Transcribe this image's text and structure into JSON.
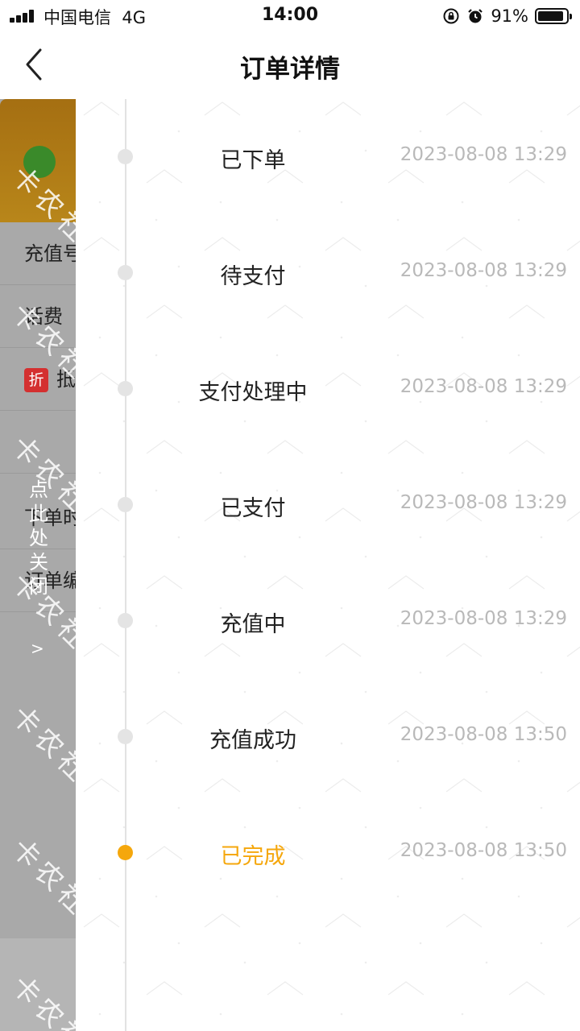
{
  "status_bar": {
    "carrier": "中国电信",
    "network": "4G",
    "time": "14:00",
    "battery_percent": "91%",
    "battery_level": 0.91,
    "icons": [
      "signal-icon",
      "rotation-lock-icon",
      "alarm-icon",
      "battery-icon"
    ]
  },
  "nav": {
    "title": "订单详情",
    "back_icon": "chevron-left-icon"
  },
  "underlay": {
    "rows": [
      "充值号",
      "话费",
      "抵",
      "下单时",
      "订单编"
    ],
    "discount_tag": "折",
    "close_hint": "点\n此\n处\n关\n闭",
    "chevron": ">",
    "watermark": "卡农社"
  },
  "timeline": {
    "accent_color": "#f5a70c",
    "steps": [
      {
        "label": "已下单",
        "time": "2023-08-08 13:29",
        "active": false
      },
      {
        "label": "待支付",
        "time": "2023-08-08 13:29",
        "active": false
      },
      {
        "label": "支付处理中",
        "time": "2023-08-08 13:29",
        "active": false
      },
      {
        "label": "已支付",
        "time": "2023-08-08 13:29",
        "active": false
      },
      {
        "label": "充值中",
        "time": "2023-08-08 13:29",
        "active": false
      },
      {
        "label": "充值成功",
        "time": "2023-08-08 13:50",
        "active": false
      },
      {
        "label": "已完成",
        "time": "2023-08-08 13:50",
        "active": true
      }
    ]
  }
}
